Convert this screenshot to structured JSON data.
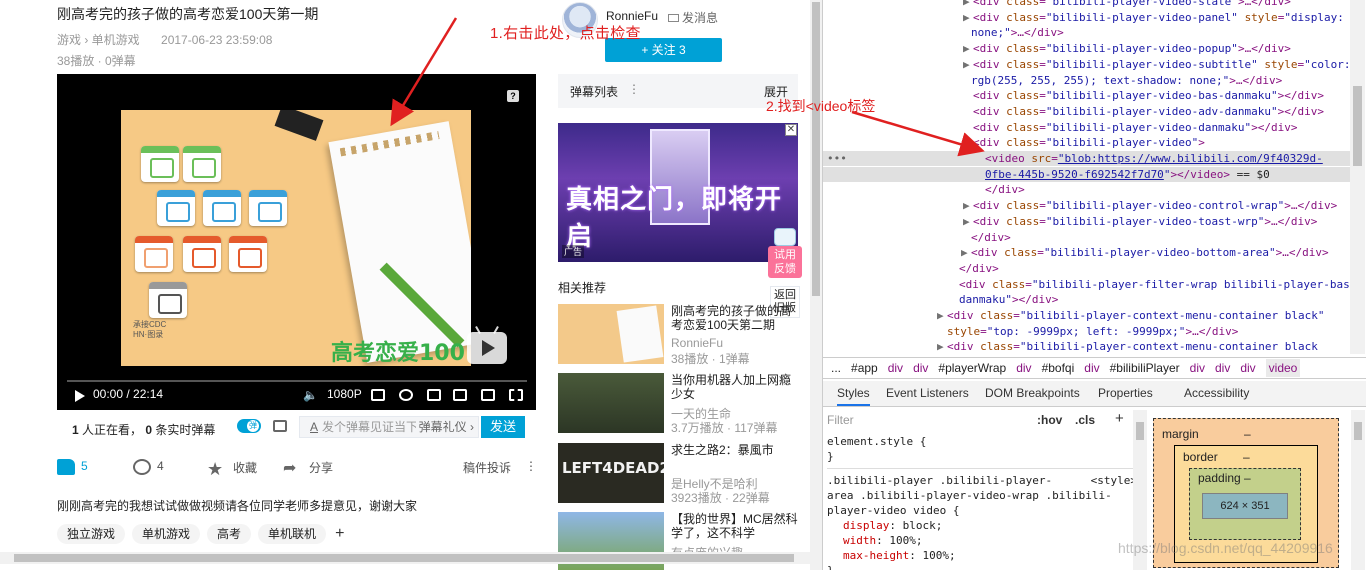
{
  "video": {
    "title": "刚高考完的孩子做的高考恋爱100天第一期",
    "category": "游戏 › 单机游戏",
    "datetime": "2017-06-23 23:59:08",
    "stats": "38播放 · 0弹幕"
  },
  "uploader": {
    "name": "RonnieFu",
    "message_label": "发消息",
    "follow_label": "+ 关注 3"
  },
  "annotations": {
    "step1": "1.右击此处，点击检查",
    "step2": "2.找到<video标签"
  },
  "player": {
    "time": "00:00 / 22:14",
    "quality": "1080P",
    "help_icon": "?",
    "brand_text": "高考恋爱100天",
    "brand_sub": "承接CDC\nHN·图录"
  },
  "danmaku_bar": {
    "watching": "1",
    "watching_label": "人正在看，",
    "live_count": "0",
    "live_label": "条实时弹幕",
    "input_icon": "A",
    "input_placeholder": "发个弹幕见证当下",
    "etiquette": "弹幕礼仪 ›",
    "send_label": "发送"
  },
  "actions": {
    "like_count": "5",
    "coin_count": "4",
    "collect_label": "收藏",
    "share_label": "分享",
    "report_label": "稿件投诉",
    "more_icon": "⋮"
  },
  "description": "刚刚高考完的我想试试做做视频请各位同学老师多提意见，谢谢大家",
  "tags": [
    "独立游戏",
    "单机游戏",
    "高考",
    "单机联机"
  ],
  "tag_add": "+",
  "sidebar": {
    "danmaku_list_label": "弹幕列表",
    "danmaku_list_more": "⋮",
    "expand_label": "展开",
    "ad_text": "真相之门，即将开启",
    "ad_tag": "广告",
    "ad_close": "✕",
    "feedback_label": "试用\n反馈",
    "old_version_label": "返回\n旧版",
    "related_title": "相关推荐"
  },
  "related": [
    {
      "title": "刚高考完的孩子做的高考恋爱100天第二期",
      "up": "RonnieFu",
      "stats": "38播放 · 1弹幕"
    },
    {
      "title": "当你用机器人加上网瘾少女",
      "up": "一天的生命",
      "stats": "3.7万播放 · 117弹幕"
    },
    {
      "title": "求生之路2：暴風市",
      "up": "是Helly不是哈利",
      "stats": "3923播放 · 22弹幕"
    },
    {
      "title": "【我的世界】MC居然科学了，这不科学",
      "up": "有点庞的兴趣",
      "stats": ""
    }
  ],
  "devtools": {
    "lines": [
      {
        "indent": 0,
        "tri": "▶",
        "html": "<span class='tn'>&lt;div</span> <span class='an'>class</span>=<span class='av'>\"bilibili-player-video-state\"</span><span class='tn'>&gt;</span>…<span class='tn'>&lt;/div&gt;</span>"
      },
      {
        "indent": 0,
        "tri": "▶",
        "html": "<span class='tn'>&lt;div</span> <span class='an'>class</span>=<span class='av'>\"bilibili-player-video-panel\"</span> <span class='an'>style</span>=<span class='av'>\"display:</span>"
      },
      {
        "indent": -1,
        "tri": "",
        "html": "<span class='av'>none;\"</span><span class='tn'>&gt;</span>…<span class='tn'>&lt;/div&gt;</span>"
      },
      {
        "indent": 0,
        "tri": "▶",
        "html": "<span class='tn'>&lt;div</span> <span class='an'>class</span>=<span class='av'>\"bilibili-player-video-popup\"</span><span class='tn'>&gt;</span>…<span class='tn'>&lt;/div&gt;</span>"
      },
      {
        "indent": 0,
        "tri": "▶",
        "html": "<span class='tn'>&lt;div</span> <span class='an'>class</span>=<span class='av'>\"bilibili-player-video-subtitle\"</span> <span class='an'>style</span>=<span class='av'>\"color:</span>"
      },
      {
        "indent": -1,
        "tri": "",
        "html": "<span class='av'>rgb(255, 255, 255); text-shadow: none;\"</span><span class='tn'>&gt;</span>…<span class='tn'>&lt;/div&gt;</span>"
      },
      {
        "indent": 0,
        "tri": "",
        "html": "<span class='tn'>&lt;div</span> <span class='an'>class</span>=<span class='av'>\"bilibili-player-video-bas-danmaku\"</span><span class='tn'>&gt;&lt;/div&gt;</span>"
      },
      {
        "indent": 0,
        "tri": "",
        "html": "<span class='tn'>&lt;div</span> <span class='an'>class</span>=<span class='av'>\"bilibili-player-video-adv-danmaku\"</span><span class='tn'>&gt;&lt;/div&gt;</span>"
      },
      {
        "indent": 0,
        "tri": "",
        "html": "<span class='tn'>&lt;div</span> <span class='an'>class</span>=<span class='av'>\"bilibili-player-video-danmaku\"</span><span class='tn'>&gt;&lt;/div&gt;</span>"
      },
      {
        "indent": 0,
        "tri": "▼",
        "html": "<span class='tn'>&lt;div</span> <span class='an'>class</span>=<span class='av'>\"bilibili-player-video\"</span><span class='tn'>&gt;</span>"
      },
      {
        "indent": 1,
        "tri": "",
        "hl": true,
        "html": "<span class='tn'>&lt;video</span> <span class='an'>src</span>=<span class='av' style='text-decoration:underline'>\"blob:https://www.bilibili.com/9f40329d-</span>"
      },
      {
        "indent": 1,
        "tri": "",
        "hl": true,
        "html": "<span class='av' style='text-decoration:underline'>0fbe-445b-9520-f692542f7d70</span><span class='av'>\"</span><span class='tn'>&gt;&lt;/video&gt;</span> <span class='tx'>== $0</span>"
      },
      {
        "indent": 1,
        "tri": "",
        "html": "<span class='tn'>&lt;/div&gt;</span>"
      },
      {
        "indent": 0,
        "tri": "▶",
        "html": "<span class='tn'>&lt;div</span> <span class='an'>class</span>=<span class='av'>\"bilibili-player-video-control-wrap\"</span><span class='tn'>&gt;</span>…<span class='tn'>&lt;/div&gt;</span>"
      },
      {
        "indent": 0,
        "tri": "▶",
        "html": "<span class='tn'>&lt;div</span> <span class='an'>class</span>=<span class='av'>\"bilibili-player-video-toast-wrp\"</span><span class='tn'>&gt;</span>…<span class='tn'>&lt;/div&gt;</span>"
      },
      {
        "indent": -2,
        "tri": "",
        "html": "<span class='tn'>&lt;/div&gt;</span>"
      },
      {
        "indent": -2,
        "tri": "▶",
        "html": "<span class='tn'>&lt;div</span> <span class='an'>class</span>=<span class='av'>\"bilibili-player-video-bottom-area\"</span><span class='tn'>&gt;</span>…<span class='tn'>&lt;/div&gt;</span>"
      },
      {
        "indent": -3,
        "tri": "",
        "html": "<span class='tn'>&lt;/div&gt;</span>"
      },
      {
        "indent": -3,
        "tri": "",
        "html": "<span class='tn'>&lt;div</span> <span class='an'>class</span>=<span class='av'>\"bilibili-player-filter-wrap bilibili-player-bas-</span>"
      },
      {
        "indent": -3,
        "tri": "",
        "html": "<span class='av'>danmaku\"</span><span class='tn'>&gt;&lt;/div&gt;</span>"
      },
      {
        "indent": -4,
        "tri": "▶",
        "html": "<span class='tn'>&lt;div</span> <span class='an'>class</span>=<span class='av'>\"bilibili-player-context-menu-container black\"</span>"
      },
      {
        "indent": -5,
        "tri": "",
        "html": "<span class='an'>style</span>=<span class='av'>\"top: -9999px; left: -9999px;\"</span><span class='tn'>&gt;</span>…<span class='tn'>&lt;/div&gt;</span>"
      },
      {
        "indent": -4,
        "tri": "▶",
        "html": "<span class='tn'>&lt;div</span> <span class='an'>class</span>=<span class='av'>\"bilibili-player-context-menu-container black</span>"
      }
    ],
    "breadcrumbs": [
      "...",
      "#app",
      "div",
      "div",
      "#playerWrap",
      "div",
      "#bofqi",
      "div",
      "#bilibiliPlayer",
      "div",
      "div",
      "div",
      "video"
    ],
    "tabs": [
      "Styles",
      "Event Listeners",
      "DOM Breakpoints",
      "Properties",
      "Accessibility"
    ],
    "filter_placeholder": "Filter",
    "hov": ":hov",
    "cls": ".cls",
    "plus": "+",
    "element_style": "element.style {",
    "close_brace": "}",
    "rule_selector_1": ".bilibili-player .bilibili-player-",
    "rule_selector_2": "area .bilibili-player-video-wrap .bilibili-",
    "rule_selector_3": "player-video video {",
    "rule_source": "<style>",
    "props": [
      {
        "name": "display",
        "value": "block;"
      },
      {
        "name": "width",
        "value": "100%;"
      },
      {
        "name": "max-height",
        "value": "100%;"
      }
    ],
    "box": {
      "margin": "margin",
      "margin_val": "–",
      "border": "border",
      "border_val": "–",
      "padding": "padding",
      "padding_val": "–",
      "content": "624 × 351"
    }
  },
  "watermark": "https://blog.csdn.net/qq_44209916"
}
